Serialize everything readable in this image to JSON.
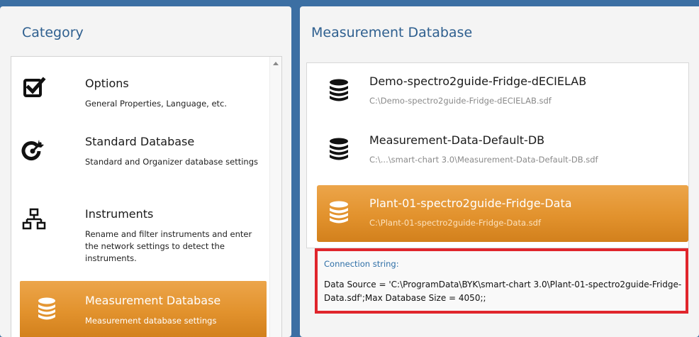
{
  "category": {
    "title": "Category",
    "items": [
      {
        "title": "Options",
        "desc": "General Properties, Language, etc.",
        "icon": "checkbox-icon"
      },
      {
        "title": "Standard Database",
        "desc": "Standard and Organizer database settings",
        "icon": "target-icon"
      },
      {
        "title": "Instruments",
        "desc": "Rename and filter instruments and enter the network settings to detect the instruments.",
        "icon": "network-icon"
      },
      {
        "title": "Measurement Database",
        "desc": "Measurement database settings",
        "icon": "database-icon"
      }
    ],
    "selected_index": 3
  },
  "measurement_db": {
    "title": "Measurement Database",
    "items": [
      {
        "name": "Demo-spectro2guide-Fridge-dECIELAB",
        "path": "C:\\Demo-spectro2guide-Fridge-dECIELAB.sdf",
        "icon": "database-icon"
      },
      {
        "name": "Measurement-Data-Default-DB",
        "path": "C:\\...\\smart-chart 3.0\\Measurement-Data-Default-DB.sdf",
        "icon": "database-icon"
      },
      {
        "name": "Plant-01-spectro2guide-Fridge-Data",
        "path": "C:\\Plant-01-spectro2guide-Fridge-Data.sdf",
        "icon": "database-icon"
      }
    ],
    "selected_index": 2,
    "connection_label": "Connection string:",
    "connection_value": "Data Source = 'C:\\ProgramData\\BYK\\smart-chart 3.0\\Plant-01-spectro2guide-Fridge-Data.sdf';Max Database Size = 4050;;"
  },
  "colors": {
    "accent_orange": "#e2922d",
    "title_blue": "#2e5f8f",
    "highlight_red": "#e0252c"
  }
}
